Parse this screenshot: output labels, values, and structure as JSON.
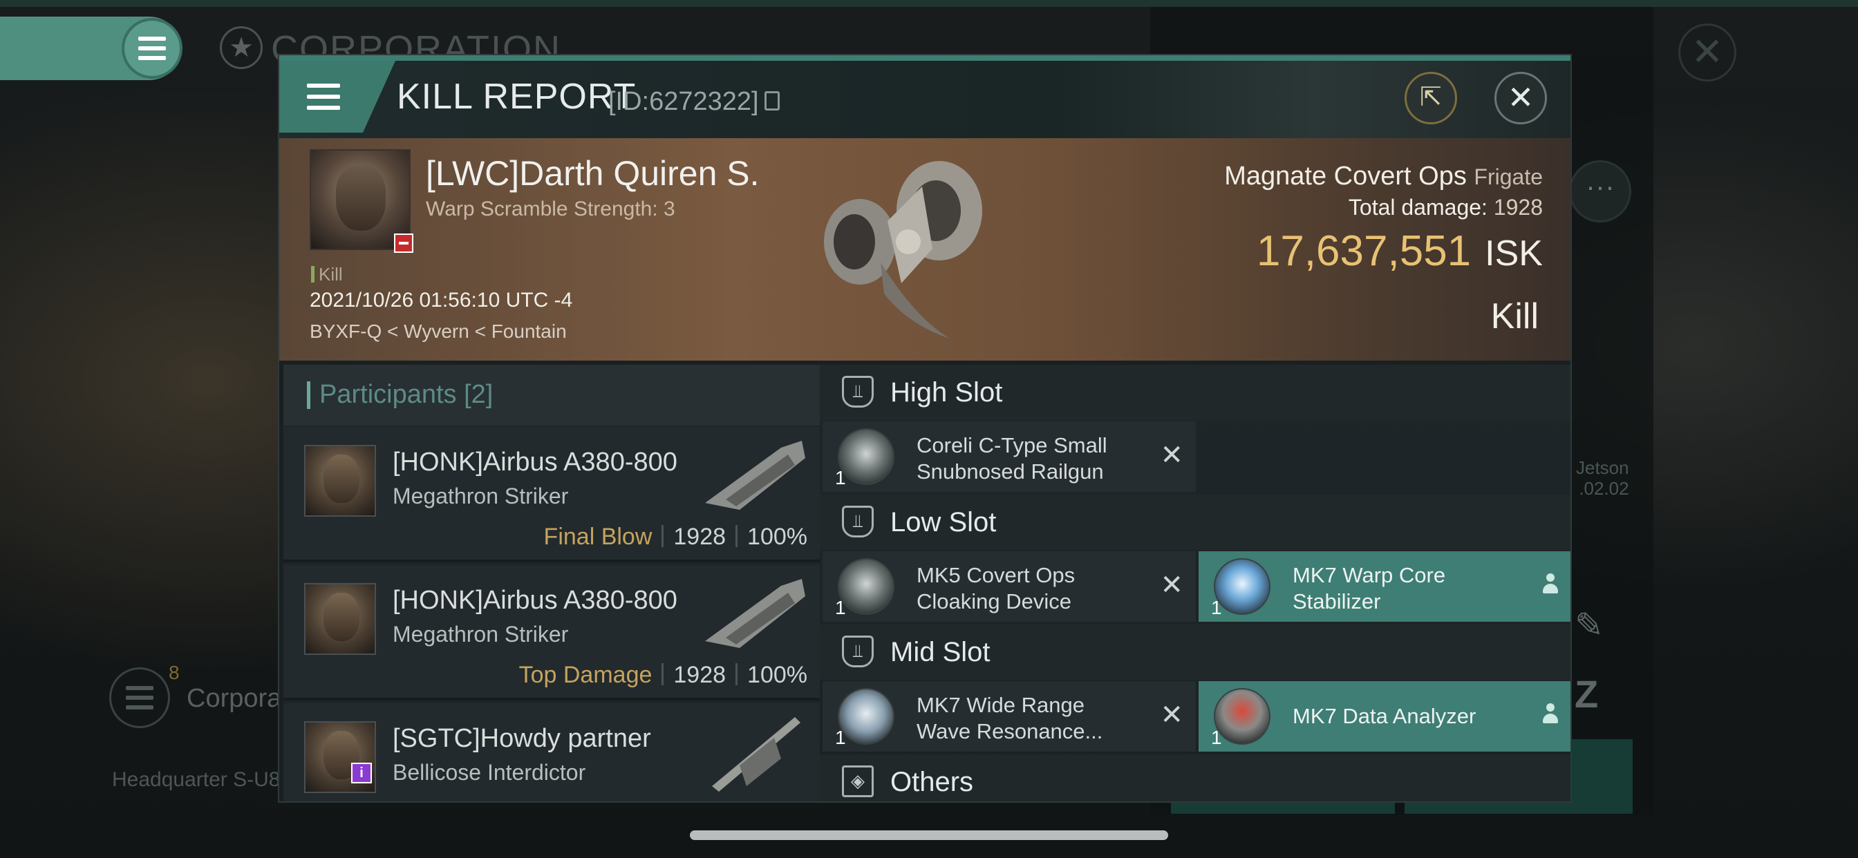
{
  "background": {
    "corp_title": "CORPORATION",
    "corp_label": "Corpora",
    "corp_count": "8",
    "headquarters": "Headquarter S-U8",
    "jetson_line1": "Jetson",
    "jetson_line2": ".02.02"
  },
  "dialog": {
    "title": "KILL REPORT",
    "id_label": "[ID:6272322]"
  },
  "victim": {
    "name": "[LWC]Darth Quiren S.",
    "subtitle": "Warp Scramble Strength: 3",
    "kill_tag": "Kill",
    "datetime": "2021/10/26 01:56:10 UTC -4",
    "location": "BYXF-Q < Wyvern < Fountain",
    "ship_name": "Magnate Covert Ops",
    "ship_class": "Frigate",
    "total_damage_label": "Total damage:",
    "total_damage": "1928",
    "isk_value": "17,637,551",
    "isk_unit": "ISK",
    "result": "Kill"
  },
  "participants": {
    "header": "Participants [2]",
    "rows": [
      {
        "name": "[HONK]Airbus A380-800",
        "ship": "Megathron Striker",
        "tag": "Final Blow",
        "damage": "1928",
        "percent": "100%"
      },
      {
        "name": "[HONK]Airbus A380-800",
        "ship": "Megathron Striker",
        "tag": "Top Damage",
        "damage": "1928",
        "percent": "100%"
      },
      {
        "name": "[SGTC]Howdy partner",
        "ship": "Bellicose Interdictor",
        "tag": "",
        "damage": "",
        "percent": ""
      }
    ]
  },
  "slots": {
    "high": {
      "label": "High Slot",
      "modules": [
        {
          "qty": "1",
          "name": "Coreli C-Type Small Snubnosed Railgun",
          "status": "destroyed"
        }
      ]
    },
    "low": {
      "label": "Low Slot",
      "modules": [
        {
          "qty": "1",
          "name": "MK5 Covert Ops Cloaking Device",
          "status": "destroyed"
        },
        {
          "qty": "1",
          "name": "MK7 Warp Core Stabilizer",
          "status": "dropped"
        }
      ]
    },
    "mid": {
      "label": "Mid Slot",
      "modules": [
        {
          "qty": "1",
          "name": "MK7 Wide Range Wave Resonance...",
          "status": "destroyed"
        },
        {
          "qty": "1",
          "name": "MK7 Data Analyzer",
          "status": "dropped"
        }
      ]
    },
    "others": {
      "label": "Others"
    }
  },
  "colors": {
    "accent_teal": "#3e7e74",
    "isk_gold": "#e8c274",
    "final_blow": "#c6a35e",
    "hostile_red": "#c62b2b"
  },
  "icons": [
    "menu-icon",
    "close-icon",
    "share-icon",
    "copy-icon",
    "more-icon",
    "slot-icon",
    "cube-icon",
    "person-icon"
  ]
}
